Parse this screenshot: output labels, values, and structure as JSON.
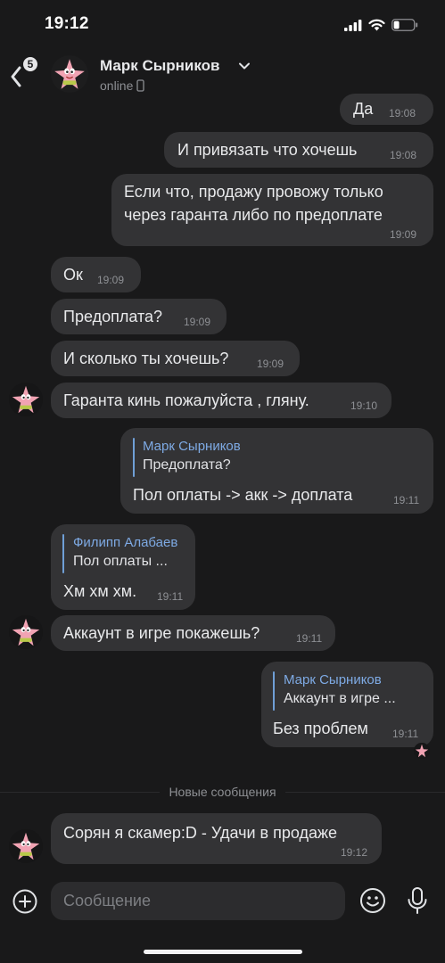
{
  "status_bar": {
    "time": "19:12"
  },
  "header": {
    "back_badge": "5",
    "contact_name": "Марк Сырников",
    "contact_status": "online"
  },
  "messages": [
    {
      "text": "Да",
      "time": "19:08"
    },
    {
      "text": "И привязать что хочешь",
      "time": "19:08"
    },
    {
      "lines": [
        "Если что, продажу провожу только",
        "через гаранта либо по предоплате"
      ],
      "time": "19:09"
    },
    {
      "text": "Ок",
      "time": "19:09"
    },
    {
      "text": "Предоплата?",
      "time": "19:09"
    },
    {
      "text": "И сколько ты хочешь?",
      "time": "19:09"
    },
    {
      "text": "Гаранта кинь пожалуйста , гляну.",
      "time": "19:10"
    },
    {
      "quote_name": "Марк Сырников",
      "quote_text": "Предоплата?",
      "text": "Пол оплаты -> акк -> доплата",
      "time": "19:11"
    },
    {
      "quote_name": "Филипп Алабаев",
      "quote_text": "Пол оплаты ...",
      "text": "Хм хм хм.",
      "time": "19:11"
    },
    {
      "text": "Аккаунт в игре покажешь?",
      "time": "19:11"
    },
    {
      "quote_name": "Марк Сырников",
      "quote_text": "Аккаунт в игре ...",
      "text": "Без проблем",
      "time": "19:11"
    },
    {
      "text": "Сорян я скамер:D - Удачи в продаже",
      "time": "19:12"
    }
  ],
  "new_messages_label": "Новые сообщения",
  "composer": {
    "placeholder": "Сообщение"
  },
  "colors": {
    "background": "#19191a",
    "bubble": "#333335",
    "quote_accent": "#7eaae4"
  },
  "icons": [
    "back-arrow-icon",
    "chevron-down-icon",
    "phone-icon",
    "add-icon",
    "emoji-icon",
    "microphone-icon",
    "signal-icon",
    "wifi-icon",
    "battery-icon"
  ]
}
